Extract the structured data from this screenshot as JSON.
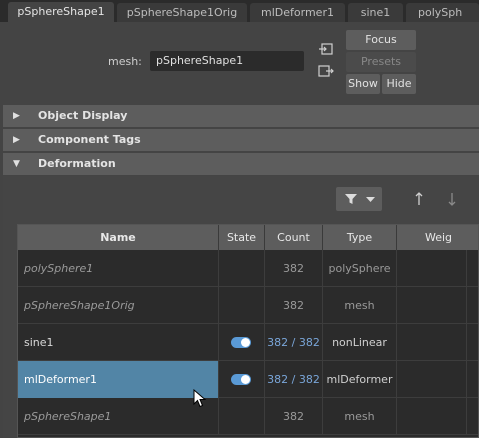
{
  "tabs": [
    "pSphereShape1",
    "pSphereShape1Orig",
    "mlDeformer1",
    "sine1",
    "polySph"
  ],
  "active_tab": "pSphereShape1",
  "mesh": {
    "label": "mesh:",
    "value": "pSphereShape1"
  },
  "buttons": {
    "focus": "Focus",
    "presets": "Presets",
    "show": "Show",
    "hide": "Hide"
  },
  "sections": [
    {
      "label": "Object Display",
      "expanded": false
    },
    {
      "label": "Component Tags",
      "expanded": false
    },
    {
      "label": "Deformation",
      "expanded": true
    }
  ],
  "table": {
    "headers": {
      "name": "Name",
      "state": "State",
      "count": "Count",
      "type": "Type",
      "weight": "Weig"
    },
    "rows": [
      {
        "name": "polySphere1",
        "state": "",
        "count": "382",
        "type": "polySphere",
        "italic": true,
        "selected": false
      },
      {
        "name": "pSphereShape1Orig",
        "state": "",
        "count": "382",
        "type": "mesh",
        "italic": true,
        "selected": false
      },
      {
        "name": "sine1",
        "state": "on",
        "count": "382 / 382",
        "type": "nonLinear",
        "italic": false,
        "selected": false
      },
      {
        "name": "mlDeformer1",
        "state": "on",
        "count": "382 / 382",
        "type": "mlDeformer",
        "italic": false,
        "selected": true
      },
      {
        "name": "pSphereShape1",
        "state": "",
        "count": "382",
        "type": "mesh",
        "italic": true,
        "selected": false
      }
    ]
  },
  "colors": {
    "accent": "#5285a6",
    "toggle": "#5a9ad6",
    "link": "#7aa6d9"
  }
}
